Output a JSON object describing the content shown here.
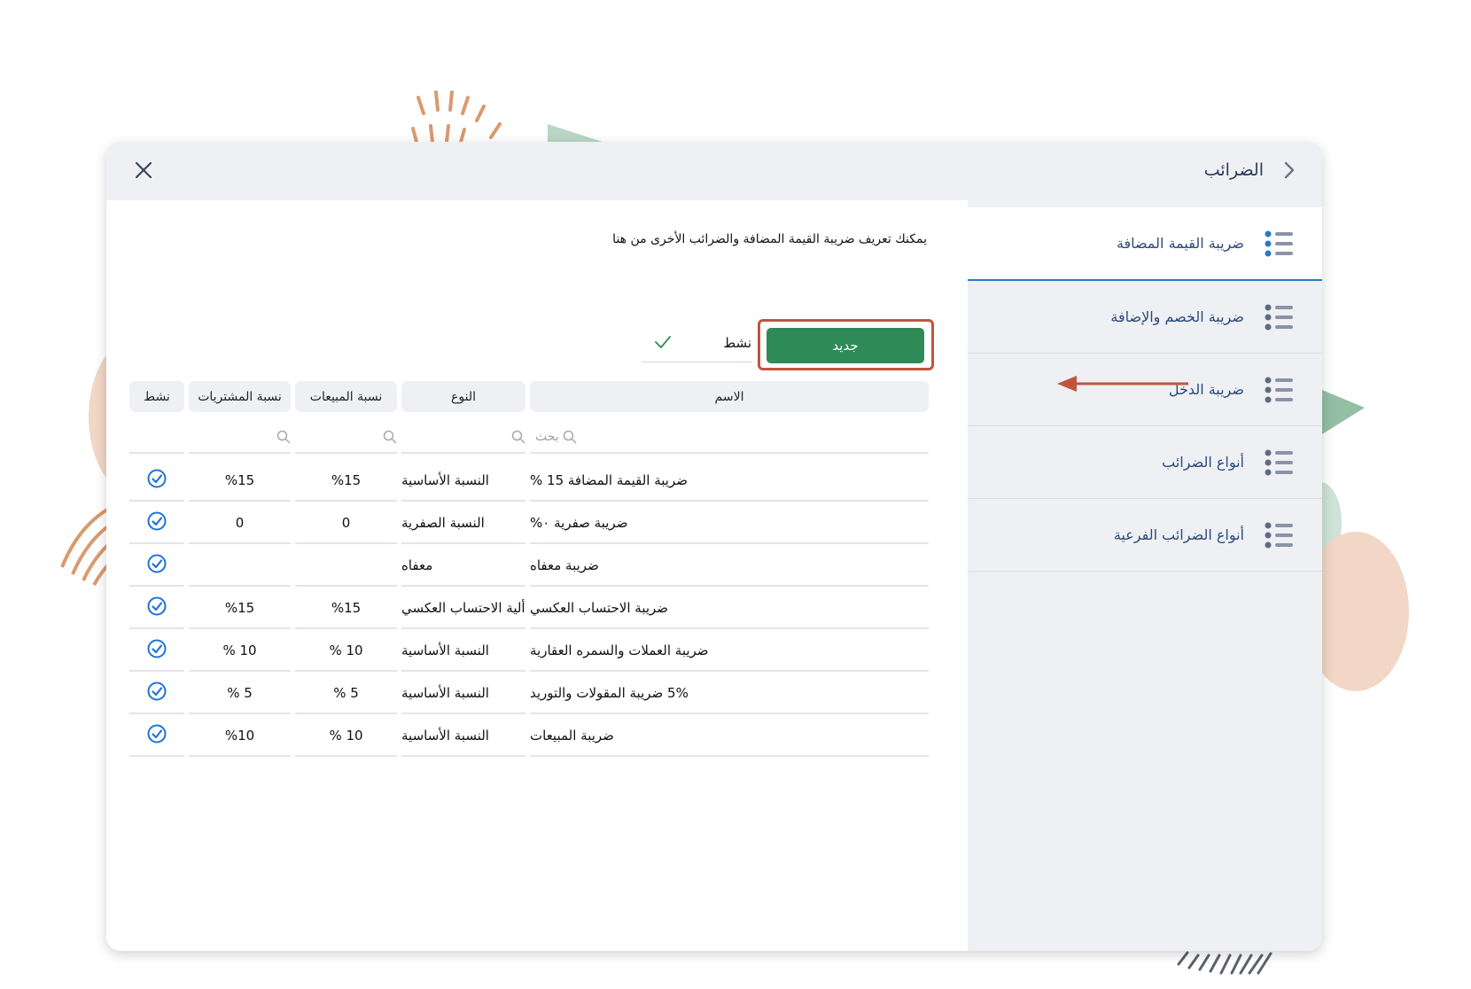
{
  "window": {
    "title": "الضرائب"
  },
  "sidebar": {
    "items": [
      {
        "label": "ضريبة القيمة المضافة",
        "active": true
      },
      {
        "label": "ضريبة الخصم والإضافة",
        "active": false
      },
      {
        "label": "ضريبة الدخل",
        "active": false
      },
      {
        "label": "أنواع الضرائب",
        "active": false
      },
      {
        "label": "أنواع الضرائب الفرعية",
        "active": false
      }
    ]
  },
  "main": {
    "description": "يمكنك تعريف ضريبة القيمة المضافة والضرائب الأخرى من هنا",
    "new_button": "جديد",
    "active_toggle": {
      "label": "نشط",
      "checked": true
    }
  },
  "table": {
    "headers": {
      "name": "الاسم",
      "type": "النوع",
      "sales": "نسبة المبيعات",
      "purchases": "نسبة المشتريات",
      "active": "نشط"
    },
    "search_placeholder": "بحث",
    "rows": [
      {
        "name": "ضريبة القيمة المضافة 15 %",
        "type": "النسبة الأساسية",
        "sales": "%15",
        "purchases": "%15",
        "active": true
      },
      {
        "name": "ضريبة صفرية ٠%",
        "type": "النسبة الصفرية",
        "sales": "0",
        "purchases": "0",
        "active": true
      },
      {
        "name": "ضريبة معفاه",
        "type": "معفاه",
        "sales": "",
        "purchases": "",
        "active": true
      },
      {
        "name": "ضريبة الاحتساب العكسي",
        "type": "ألية الاحتساب العكسي",
        "sales": "%15",
        "purchases": "%15",
        "active": true
      },
      {
        "name": "ضريبة العملات والسمره العقارية",
        "type": "النسبة الأساسية",
        "sales": "% 10",
        "purchases": "% 10",
        "active": true
      },
      {
        "name": "5% ضريبة المقولات والتوريد",
        "type": "النسبة الأساسية",
        "sales": "% 5",
        "purchases": "% 5",
        "active": true
      },
      {
        "name": "ضريبة المبيعات",
        "type": "النسبة الأساسية",
        "sales": "% 10",
        "purchases": "%10",
        "active": true
      }
    ]
  },
  "colors": {
    "primary_button": "#2e8b57",
    "highlight_frame": "#c0553e",
    "active_tab_underline": "#2a78c8",
    "check_icon": "#1e73d8"
  },
  "icons": {
    "close": "close-icon",
    "back": "chevron-right-icon",
    "sidebar_item": "list-icon",
    "search": "search-icon",
    "active_check": "check-circle-icon",
    "toggle_check": "check-icon",
    "annotation": "arrow-left-icon"
  }
}
